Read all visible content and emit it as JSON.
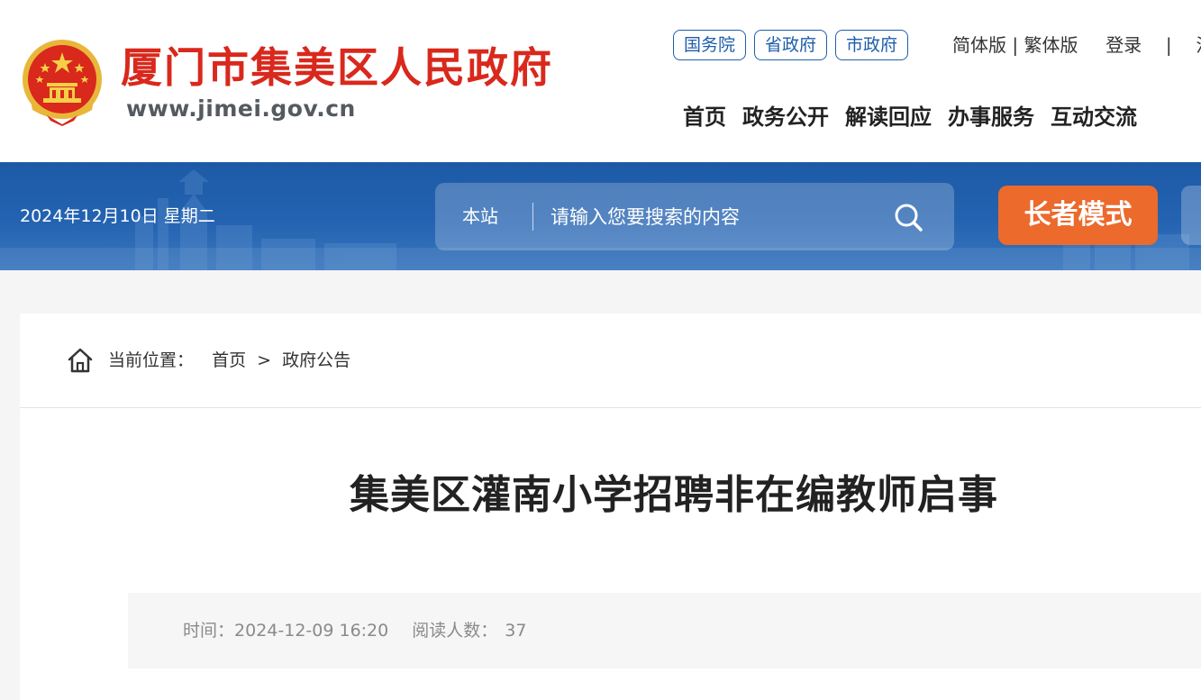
{
  "header": {
    "site_name": "厦门市集美区人民政府",
    "site_url": "www.jimei.gov.cn",
    "gov_links": [
      "国务院",
      "省政府",
      "市政府"
    ],
    "lang_simplified": "简体版",
    "lang_traditional": "繁体版",
    "lang_separator": "|",
    "login": "登录",
    "util_separator": "|",
    "register": "注册",
    "nav": [
      "首页",
      "政务公开",
      "解读回应",
      "办事服务",
      "互动交流"
    ]
  },
  "banner": {
    "date": "2024年12月10日 星期二",
    "search_scope": "本站",
    "search_placeholder": "请输入您要搜索的内容",
    "elder_mode": "长者模式"
  },
  "breadcrumb": {
    "label": "当前位置：",
    "home": "首页",
    "separator": ">",
    "current": "政府公告"
  },
  "article": {
    "title": "集美区灌南小学招聘非在编教师启事",
    "time_label": "时间：",
    "time_value": "2024-12-09 16:20",
    "reads_label": "阅读人数：",
    "reads_value": "37"
  },
  "colors": {
    "brand_red": "#d9281c",
    "banner_blue": "#1d5aa6",
    "link_blue": "#1e5eaa",
    "elder_orange": "#ec6a2c"
  }
}
